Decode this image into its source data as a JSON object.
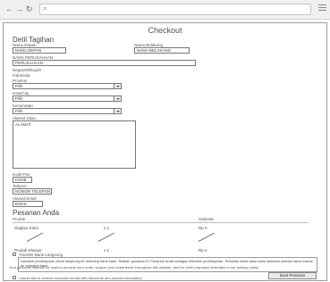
{
  "browser": {
    "back_glyph": "←",
    "forward_glyph": "→",
    "reload_glyph": "↻",
    "search_glyph": "⌕"
  },
  "page_title": "Checkout",
  "detail": {
    "heading": "Detil Tagihan",
    "first_name_label": "Nama Depan",
    "first_name_value": "NAMA DEPAN",
    "last_name_label": "Nama Belakang",
    "last_name_value": "NAMA BELAKANG",
    "company_label": "NAMA PERUSAHAAN",
    "company_value": "PERUSAHAAN",
    "region_label": "Negara/Wilayah",
    "region_value": "Indonesia",
    "province_label": "Provinsi",
    "province_value": "Pilih",
    "city_label": "Kota/City",
    "city_value": "Pilih",
    "district_label": "Kecamatan",
    "district_value": "Pilih",
    "address_label": "Alamat Jalan",
    "address_value": "ALAMAT",
    "postcode_label": "Kode Pos",
    "postcode_value": "KODE",
    "phone_label": "Telepon",
    "phone_value": "NOMOR TELEPON",
    "email_label": "Alamat Email",
    "email_value": "EMAIL"
  },
  "order": {
    "heading": "Pesanan Anda",
    "col_product": "Produk",
    "col_subtotal": "Subtotal",
    "rows": [
      {
        "product": "Ongkos Kirim",
        "qty": "x 1",
        "subtotal": "Rp 0"
      },
      {
        "product": "Produk Khusus",
        "qty": "x 1",
        "subtotal": "Rp 0"
      }
    ]
  },
  "payment": {
    "method_label": "Transfer Bank Langsung",
    "method_desc": "Lakukan pembayaran Anda langsung ke rekening bank kami. Silakan gunakan ID Pesanan Anda sebagai referensi pembayaran. Pesanan Anda akan kami kirimkan setelah dana masuk ke rekening kami.",
    "newsletter_label": "I would like to receive exclusive emails with discounts and product information",
    "privacy_text": "Your personal data will be used to process your order, support your experience throughout this website, and for other purposes described in our privacy policy.",
    "place_order_label": "Buat Pesanan"
  }
}
